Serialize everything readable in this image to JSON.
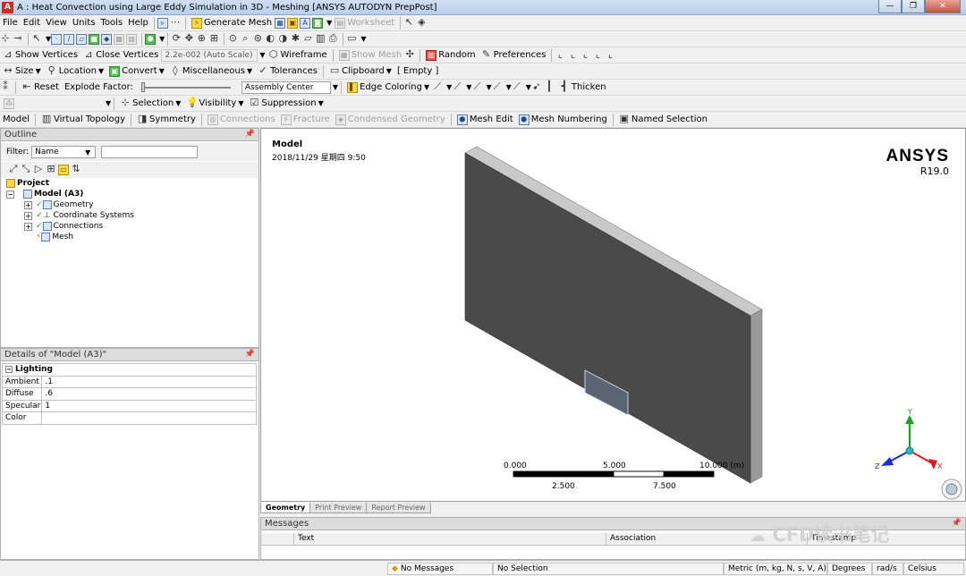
{
  "window": {
    "title": "A : Heat Convection using Large Eddy Simulation in 3D - Meshing [ANSYS AUTODYN PrepPost]",
    "logo": "A",
    "controls": [
      "—",
      "❐",
      "✕"
    ]
  },
  "menu": {
    "items": [
      "File",
      "Edit",
      "View",
      "Units",
      "Tools",
      "Help"
    ],
    "generate_mesh": "Generate Mesh",
    "worksheet": "Worksheet"
  },
  "toolbar3": {
    "show_vertices": "Show Vertices",
    "close_vertices": "Close Vertices",
    "auto_scale": "2.2e-002 (Auto Scale)",
    "wireframe": "Wireframe",
    "show_mesh": "Show Mesh",
    "random": "Random",
    "preferences": "Preferences"
  },
  "toolbar4": {
    "size": "Size",
    "location": "Location",
    "convert": "Convert",
    "miscellaneous": "Miscellaneous",
    "tolerances": "Tolerances",
    "clipboard": "Clipboard",
    "clipboard_value": "[ Empty ]"
  },
  "toolbar5": {
    "reset": "Reset",
    "explode_factor": "Explode Factor:",
    "assembly_center": "Assembly Center",
    "edge_coloring": "Edge Coloring",
    "thicken": "Thicken"
  },
  "toolbar6": {
    "selection": "Selection",
    "visibility": "Visibility",
    "suppression": "Suppression"
  },
  "toolbar7": {
    "model": "Model",
    "virtual_topology": "Virtual Topology",
    "symmetry": "Symmetry",
    "connections": "Connections",
    "fracture": "Fracture",
    "condensed_geometry": "Condensed Geometry",
    "mesh_edit": "Mesh Edit",
    "mesh_numbering": "Mesh Numbering",
    "named_selection": "Named Selection"
  },
  "outline": {
    "header": "Outline",
    "filter_label": "Filter:",
    "filter_value": "Name",
    "tree": [
      {
        "label": "Project",
        "level": 0,
        "bold": true
      },
      {
        "label": "Model (A3)",
        "level": 1,
        "bold": true
      },
      {
        "label": "Geometry",
        "level": 2
      },
      {
        "label": "Coordinate Systems",
        "level": 2
      },
      {
        "label": "Connections",
        "level": 2
      },
      {
        "label": "Mesh",
        "level": 2
      }
    ]
  },
  "details": {
    "header": "Details of \"Model (A3)\"",
    "group": "Lighting",
    "rows": [
      {
        "label": "Ambient",
        "value": ".1"
      },
      {
        "label": "Diffuse",
        "value": ".6"
      },
      {
        "label": "Specular",
        "value": "1"
      },
      {
        "label": "Color",
        "value": ""
      }
    ]
  },
  "viewport": {
    "title": "Model",
    "date": "2018/11/29 星期四 9:50",
    "brand": "ANSYS",
    "version": "R19.0",
    "scale": {
      "labels_top": [
        "0.000",
        "5.000",
        "10.000 (m)"
      ],
      "labels_bottom": [
        "2.500",
        "7.500"
      ]
    },
    "axes": {
      "x": "X",
      "y": "Y",
      "z": "Z"
    }
  },
  "bottom_tabs": [
    "Geometry",
    "Print Preview",
    "Report Preview"
  ],
  "messages": {
    "header": "Messages",
    "col_text": "Text",
    "col_association": "Association",
    "col_timestamp": "Timestamp"
  },
  "status": {
    "messages": "No Messages",
    "selection": "No Selection",
    "units": "Metric (m, kg, N, s, V, A)",
    "degrees": "Degrees",
    "rads": "rad/s",
    "temp": "Celsius"
  },
  "watermark": "CFD读书笔记",
  "colors": {
    "model_face": "#4a4a4a",
    "model_top": "#c9c9c9",
    "model_side": "#9a9a9a",
    "accent": "#1f4a8a"
  }
}
